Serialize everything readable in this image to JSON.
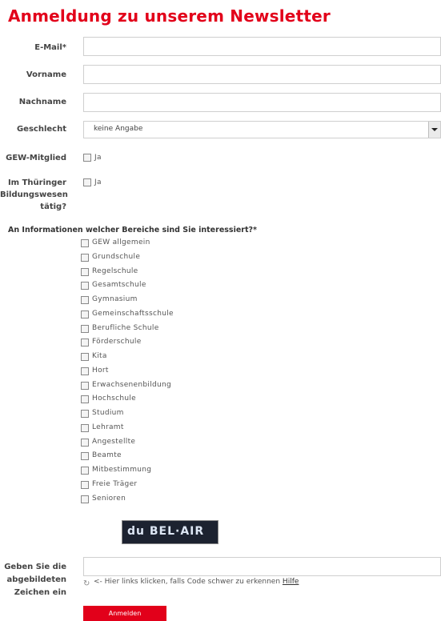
{
  "page": {
    "title": "Anmeldung zu unserem Newsletter"
  },
  "form": {
    "email_label": "E-Mail*",
    "firstname_label": "Vorname",
    "lastname_label": "Nachname",
    "gender_label": "Geschlecht",
    "gender_value": "keine Angabe",
    "gew_label": "GEW-Mitglied",
    "gew_checkbox_label": "Ja",
    "thuringen_label_line1": "Im Thüringer",
    "thuringen_label_line2": "Bildungswesen",
    "thuringen_label_line3": "tätig?",
    "thuringen_checkbox_label": "Ja",
    "interests_heading": "An Informationen welcher Bereiche sind Sie interessiert?*",
    "interests": [
      "GEW allgemein",
      "Grundschule",
      "Regelschule",
      "Gesamtschule",
      "Gymnasium",
      "Gemeinschaftsschule",
      "Berufliche Schule",
      "Förderschule",
      "Kita",
      "Hort",
      "Erwachsenenbildung",
      "Hochschule",
      "Studium",
      "Lehramt",
      "Angestellte",
      "Beamte",
      "Mitbestimmung",
      "Freie Träger",
      "Senioren"
    ],
    "captcha_text": "du BEL·AIR",
    "captcha_label_line1": "Geben Sie die",
    "captcha_label_line2": "abgebildeten",
    "captcha_label_line3": "Zeichen ein",
    "captcha_hint": "<- Hier links klicken, falls Code schwer zu erkennen",
    "captcha_help": "Hilfe",
    "submit_label": "Anmelden"
  },
  "colors": {
    "accent": "#e2001a"
  }
}
